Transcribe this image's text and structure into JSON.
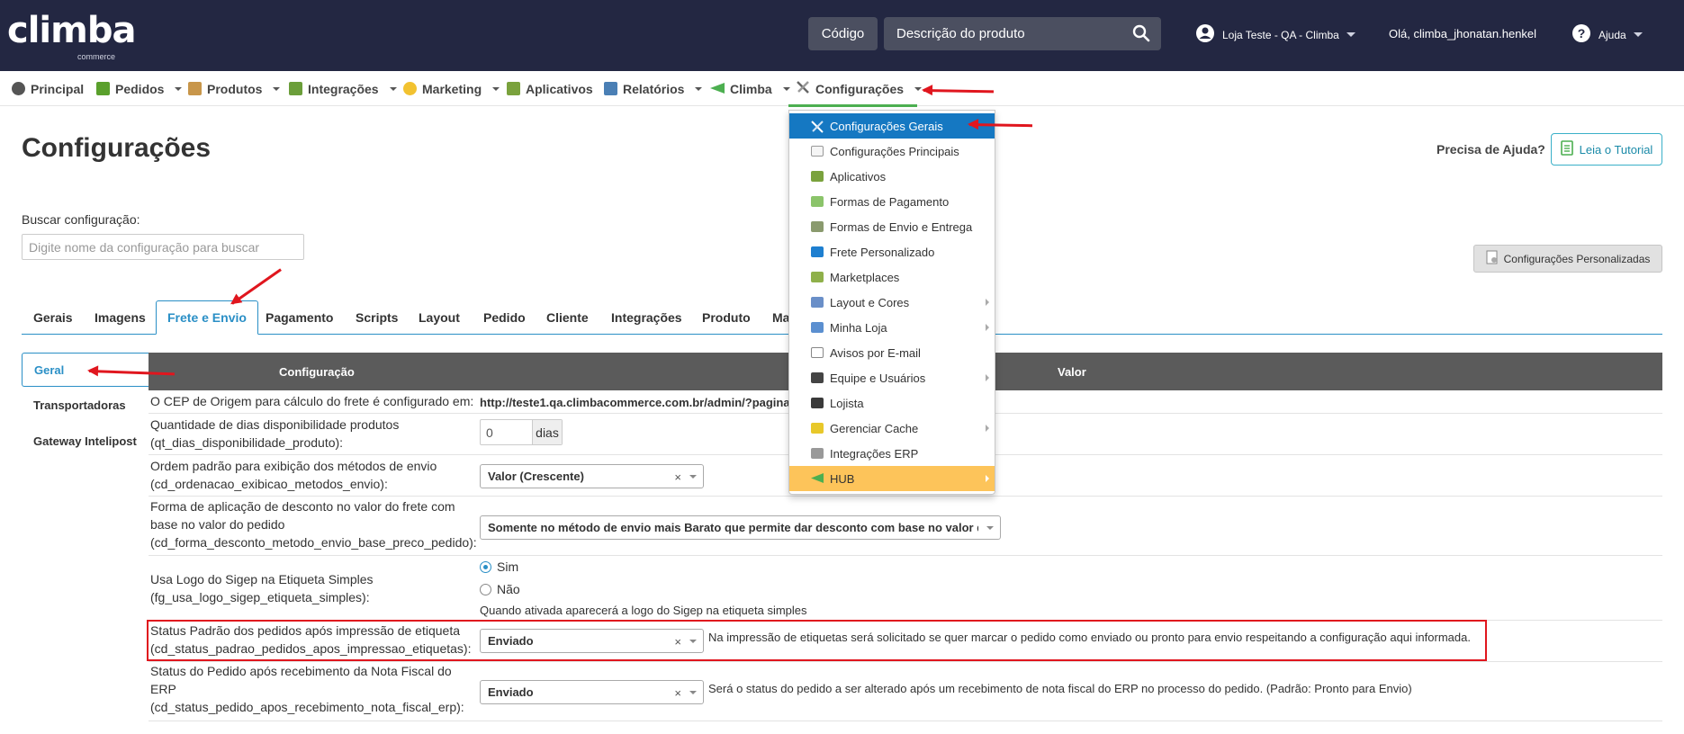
{
  "header": {
    "logo_text": "climba",
    "logo_sub": "commerce",
    "code_button": "Código",
    "search_placeholder": "Descrição do produto",
    "store": "Loja Teste - QA - Climba",
    "greeting": "Olá, climba_jhonatan.henkel",
    "help": "Ajuda"
  },
  "nav": {
    "items": [
      {
        "label": "Principal",
        "icon": "globe-icon",
        "caret": false
      },
      {
        "label": "Pedidos",
        "icon": "cart-icon",
        "caret": true
      },
      {
        "label": "Produtos",
        "icon": "box-icon",
        "caret": true
      },
      {
        "label": "Integrações",
        "icon": "plug-icon",
        "caret": true
      },
      {
        "label": "Marketing",
        "icon": "bulb-icon",
        "caret": true
      },
      {
        "label": "Aplicativos",
        "icon": "puzzle-icon",
        "caret": false
      },
      {
        "label": "Relatórios",
        "icon": "chart-icon",
        "caret": true
      },
      {
        "label": "Climba",
        "icon": "climba-flag-icon",
        "caret": true
      },
      {
        "label": "Configurações",
        "icon": "tools-icon",
        "caret": true
      }
    ]
  },
  "page": {
    "title": "Configurações",
    "help_question": "Precisa de Ajuda?",
    "tutorial_button": "Leia o Tutorial",
    "search_label": "Buscar configuração:",
    "search_placeholder": "Digite nome da configuração para buscar",
    "custom_button": "Configurações Personalizadas"
  },
  "tabs": [
    "Gerais",
    "Imagens",
    "Frete e Envio",
    "Pagamento",
    "Scripts",
    "Layout",
    "Pedido",
    "Cliente",
    "Integrações",
    "Produto",
    "Ma"
  ],
  "active_tab": "Frete e Envio",
  "side_menu": [
    "Geral",
    "Transportadoras",
    "Gateway Intelipost"
  ],
  "table": {
    "col_config": "Configuração",
    "col_value": "Valor",
    "rows": {
      "cep": {
        "label": "O CEP de Origem para cálculo do frete é configurado em:",
        "link": "http://teste1.qa.climbacommerce.com.br/admin/?pagina"
      },
      "dias": {
        "label1": "Quantidade de dias disponibilidade produtos",
        "label2": "(qt_dias_disponibilidade_produto):",
        "value": "0",
        "suffix": "dias"
      },
      "ordem": {
        "label1": "Ordem padrão para exibição dos métodos de envio",
        "label2": "(cd_ordenacao_exibicao_metodos_envio):",
        "value": "Valor (Crescente)"
      },
      "desconto": {
        "label1": "Forma de aplicação de desconto no valor do frete com",
        "label2": "base no valor do pedido",
        "label3": "(cd_forma_desconto_metodo_envio_base_preco_pedido):",
        "value": "Somente no método de envio mais Barato que permite dar desconto com base no valor do pedido"
      },
      "sigep": {
        "label1": "Usa Logo do Sigep na Etiqueta Simples",
        "label2": "(fg_usa_logo_sigep_etiqueta_simples):",
        "opt_yes": "Sim",
        "opt_no": "Não",
        "hint": "Quando ativada aparecerá a logo do Sigep na etiqueta simples"
      },
      "status_etiqueta": {
        "label1": "Status Padrão dos pedidos após impressão de etiqueta",
        "label2": "(cd_status_padrao_pedidos_apos_impressao_etiquetas):",
        "value": "Enviado",
        "hint": "Na impressão de etiquetas será solicitado se quer marcar o pedido como enviado ou pronto para envio respeitando a configuração aqui informada."
      },
      "status_nf": {
        "label1": "Status do Pedido após recebimento da Nota Fiscal do",
        "label2": "ERP",
        "label3": "(cd_status_pedido_apos_recebimento_nota_fiscal_erp):",
        "value": "Enviado",
        "hint": "Será o status do pedido a ser alterado após um recebimento de nota fiscal do ERP no processo do pedido. (Padrão: Pronto para Envio)"
      }
    }
  },
  "dropdown": {
    "items": [
      {
        "label": "Configurações Gerais",
        "icon": "tools-icon",
        "submenu": false
      },
      {
        "label": "Configurações Principais",
        "icon": "page-gear-icon",
        "submenu": false
      },
      {
        "label": "Aplicativos",
        "icon": "puzzle-icon",
        "submenu": false
      },
      {
        "label": "Formas de Pagamento",
        "icon": "money-icon",
        "submenu": false
      },
      {
        "label": "Formas de Envio e Entrega",
        "icon": "truck-icon",
        "submenu": false
      },
      {
        "label": "Frete Personalizado",
        "icon": "blue-truck-icon",
        "submenu": false
      },
      {
        "label": "Marketplaces",
        "icon": "basket-icon",
        "submenu": false
      },
      {
        "label": "Layout e Cores",
        "icon": "brush-icon",
        "submenu": true
      },
      {
        "label": "Minha Loja",
        "icon": "house-icon",
        "submenu": true
      },
      {
        "label": "Avisos por E-mail",
        "icon": "envelope-icon",
        "submenu": false
      },
      {
        "label": "Equipe e Usuários",
        "icon": "user-suit-icon",
        "submenu": true
      },
      {
        "label": "Lojista",
        "icon": "user-icon",
        "submenu": false
      },
      {
        "label": "Gerenciar Cache",
        "icon": "lightning-icon",
        "submenu": true
      },
      {
        "label": "Integrações ERP",
        "icon": "gears-icon",
        "submenu": false
      },
      {
        "label": "HUB",
        "icon": "climba-flag-icon",
        "submenu": true
      }
    ]
  },
  "colors": {
    "header_bg": "#232742",
    "accent": "#2a8fc6",
    "selected_menu": "#1578c2",
    "hub_highlight": "#fdc45a",
    "annotation_red": "#e0161e",
    "table_header": "#5b5b5b"
  }
}
